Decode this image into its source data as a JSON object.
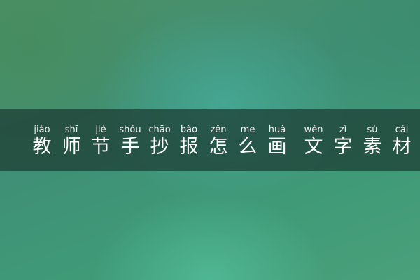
{
  "title": {
    "chars": [
      {
        "hanzi": "教",
        "pinyin": "jiào"
      },
      {
        "hanzi": "师",
        "pinyin": "shī"
      },
      {
        "hanzi": "节",
        "pinyin": "jié"
      },
      {
        "hanzi": "手",
        "pinyin": "shǒu"
      },
      {
        "hanzi": "抄",
        "pinyin": "chāo"
      },
      {
        "hanzi": "报",
        "pinyin": "bào"
      },
      {
        "hanzi": "怎",
        "pinyin": "zěn"
      },
      {
        "hanzi": "么",
        "pinyin": "me"
      },
      {
        "hanzi": "画",
        "pinyin": "huà"
      },
      {
        "hanzi": "文",
        "pinyin": "wén"
      },
      {
        "hanzi": "字",
        "pinyin": "zì"
      },
      {
        "hanzi": "素",
        "pinyin": "sù"
      },
      {
        "hanzi": "材",
        "pinyin": "cái"
      }
    ]
  },
  "colors": {
    "banner": "#1c3a32",
    "text": "#ffffff",
    "background": "#3f9a78"
  }
}
